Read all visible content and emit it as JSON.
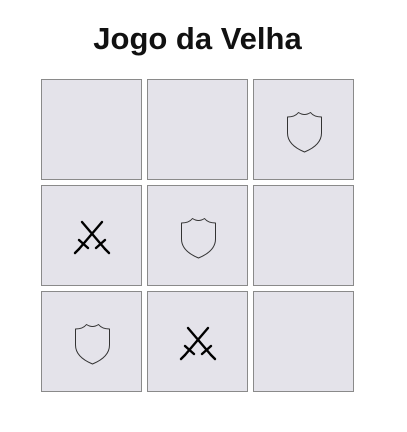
{
  "game": {
    "title": "Jogo da Velha",
    "board": [
      [
        "",
        "",
        "shield"
      ],
      [
        "swords",
        "shield",
        ""
      ],
      [
        "shield",
        "swords",
        ""
      ]
    ],
    "colors": {
      "cell_background": "#e4e3ea",
      "cell_border": "#8a8a8a",
      "piece_stroke": "#333333",
      "swords_stroke": "#000000",
      "title": "#111111"
    },
    "icons": {
      "shield": "shield-icon",
      "swords": "crossed-swords-icon"
    }
  }
}
